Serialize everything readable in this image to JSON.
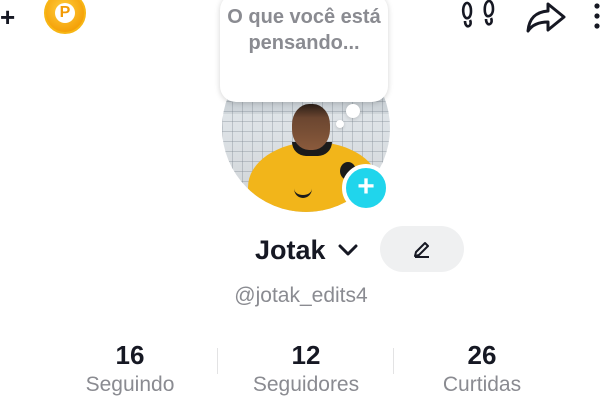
{
  "topbar": {
    "plus_icon": "+",
    "coin_label": "P",
    "icons": [
      "plus-icon",
      "coin-icon",
      "footprints-icon",
      "share-icon",
      "more-icon"
    ]
  },
  "bubble": {
    "text": "O que você está pensando..."
  },
  "profile": {
    "display_name": "Jotak",
    "username": "@jotak_edits4",
    "add_story_icon": "+"
  },
  "stats": [
    {
      "value": "16",
      "label": "Seguindo"
    },
    {
      "value": "12",
      "label": "Seguidores"
    },
    {
      "value": "26",
      "label": "Curtidas"
    }
  ],
  "colors": {
    "accent": "#20d5ec",
    "coin": "#f5a20a",
    "text_primary": "#161823",
    "text_secondary": "#8a8b91"
  }
}
